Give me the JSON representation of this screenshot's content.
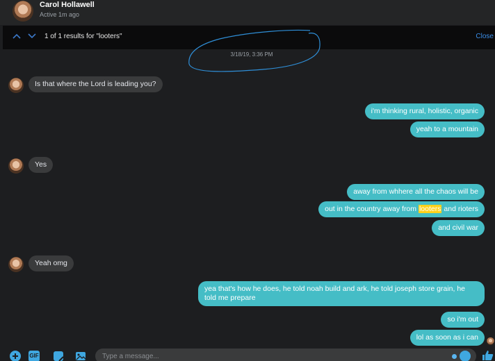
{
  "header": {
    "name": "Carol Hollawell",
    "status": "Active 1m ago"
  },
  "search": {
    "results_text": "1 of 1 results for \"looters\"",
    "close_label": "Close"
  },
  "timestamp": "3/18/19, 3:36 PM",
  "messages": {
    "in_1": "Is that where the Lord is leading you?",
    "out_1": "i'm thinking rural, holistic, organic",
    "out_2": "yeah to a mountain",
    "in_2": "Yes",
    "out_3": "away from whhere all the chaos will be",
    "out_4_pre": "out in the country away from ",
    "out_4_hl": "looters",
    "out_4_post": " and rioters",
    "out_5": "and civil war",
    "in_3": "Yeah omg",
    "out_6": "yea that's how he does, he told noah build and ark, he told joseph store grain, he told me prepare",
    "out_7": "so i'm out",
    "out_8": "lol as soon as i can"
  },
  "composer": {
    "placeholder": "Type a message...",
    "gif_label": "GIF"
  },
  "colors": {
    "outgoing": "#45bdc6",
    "incoming": "#3a3b3c",
    "highlight": "#ffd11a",
    "accent": "#3fa7e0"
  }
}
